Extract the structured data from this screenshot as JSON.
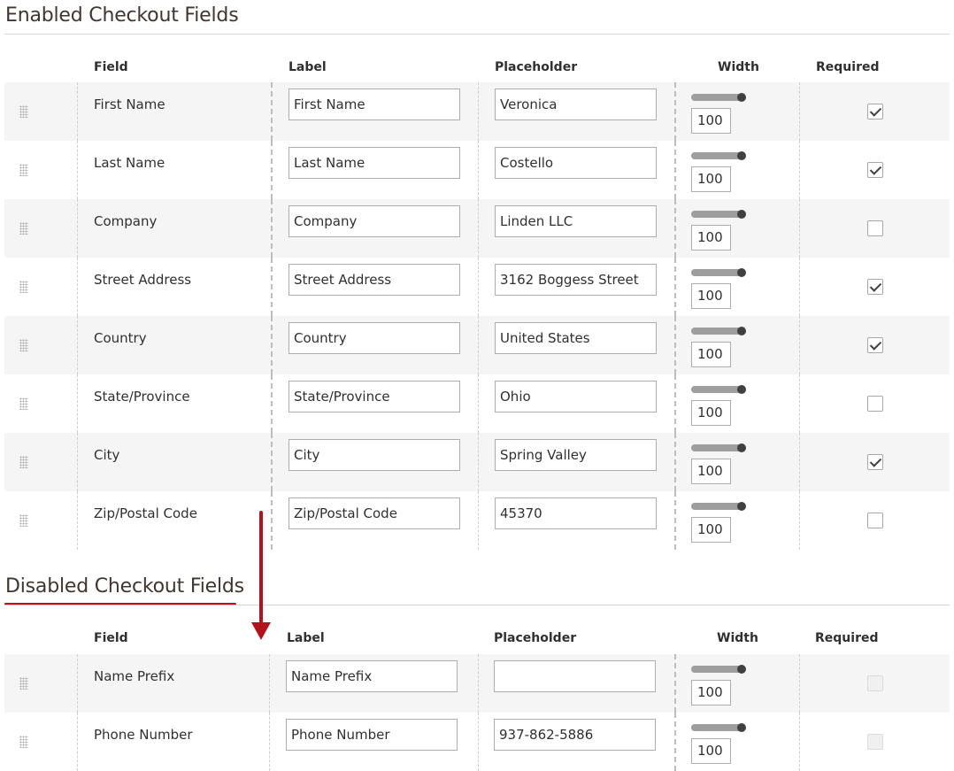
{
  "enabled": {
    "title": "Enabled Checkout Fields",
    "headers": {
      "field": "Field",
      "label": "Label",
      "placeholder": "Placeholder",
      "width": "Width",
      "required": "Required"
    },
    "rows": [
      {
        "field": "First Name",
        "label": "First Name",
        "placeholder": "Veronica",
        "width": "100",
        "required": true
      },
      {
        "field": "Last Name",
        "label": "Last Name",
        "placeholder": "Costello",
        "width": "100",
        "required": true
      },
      {
        "field": "Company",
        "label": "Company",
        "placeholder": "Linden LLC",
        "width": "100",
        "required": false
      },
      {
        "field": "Street Address",
        "label": "Street Address",
        "placeholder": "3162 Boggess Street",
        "width": "100",
        "required": true
      },
      {
        "field": "Country",
        "label": "Country",
        "placeholder": "United States",
        "width": "100",
        "required": true
      },
      {
        "field": "State/Province",
        "label": "State/Province",
        "placeholder": "Ohio",
        "width": "100",
        "required": false
      },
      {
        "field": "City",
        "label": "City",
        "placeholder": "Spring Valley",
        "width": "100",
        "required": true
      },
      {
        "field": "Zip/Postal Code",
        "label": "Zip/Postal Code",
        "placeholder": "45370",
        "width": "100",
        "required": false
      }
    ]
  },
  "disabled": {
    "title": "Disabled Checkout Fields",
    "headers": {
      "field": "Field",
      "label": "Label",
      "placeholder": "Placeholder",
      "width": "Width",
      "required": "Required"
    },
    "rows": [
      {
        "field": "Name Prefix",
        "label": "Name Prefix",
        "placeholder": "",
        "width": "100",
        "required": false
      },
      {
        "field": "Phone Number",
        "label": "Phone Number",
        "placeholder": "937-862-5886",
        "width": "100",
        "required": false
      }
    ]
  },
  "colors": {
    "accent": "#b3111c",
    "row_alt": "#f5f5f5",
    "title": "#41362f"
  },
  "icons": {
    "drag": "drag-handle-icon",
    "arrow": "arrow-down-icon"
  }
}
